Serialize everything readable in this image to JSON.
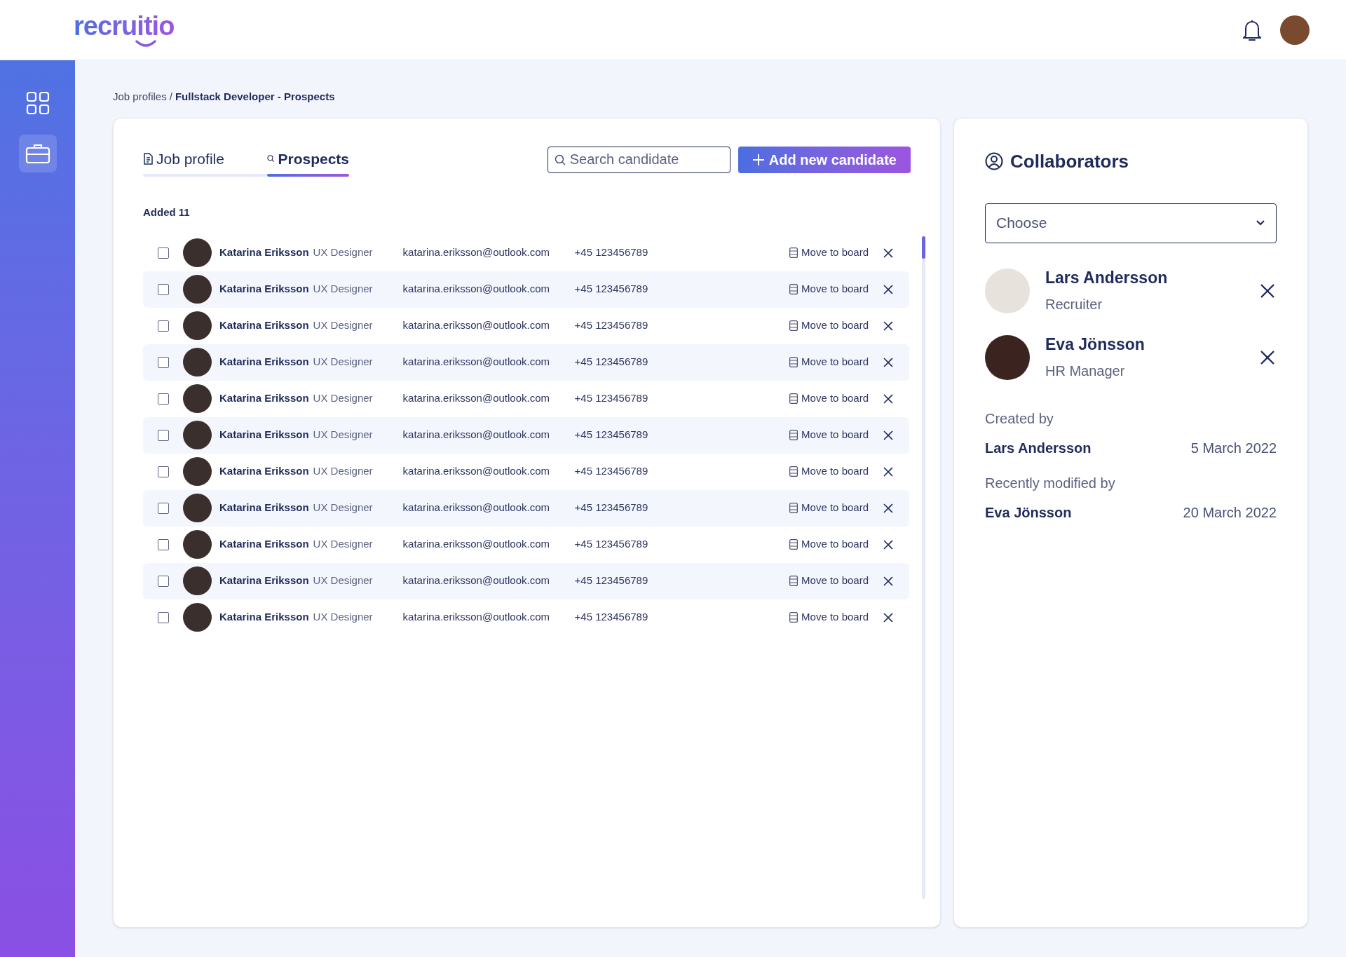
{
  "header": {
    "logo": "recruitio"
  },
  "sidebar": {
    "items": [
      {
        "kind": "grid",
        "selected": false
      },
      {
        "kind": "briefcase",
        "selected": true
      }
    ]
  },
  "breadcrumb": {
    "parent": "Job profiles",
    "separator": "/",
    "current": "Fullstack Developer - Prospects"
  },
  "tabs": [
    {
      "label": "Job profile",
      "kind": "document",
      "selected": false
    },
    {
      "label": "Prospects",
      "kind": "search",
      "selected": true
    }
  ],
  "search": {
    "placeholder": "Search candidate"
  },
  "add_button": {
    "label": "Add new candidate"
  },
  "list_title": "Added 11",
  "candidates": [
    {
      "name": "Katarina Eriksson",
      "role": "UX Designer",
      "email": "katarina.eriksson@outlook.com",
      "phone": "+45 123456789",
      "action": "Move to board",
      "checked": false
    },
    {
      "name": "Katarina Eriksson",
      "role": "UX Designer",
      "email": "katarina.eriksson@outlook.com",
      "phone": "+45 123456789",
      "action": "Move to board",
      "checked": false
    },
    {
      "name": "Katarina Eriksson",
      "role": "UX Designer",
      "email": "katarina.eriksson@outlook.com",
      "phone": "+45 123456789",
      "action": "Move to board",
      "checked": false
    },
    {
      "name": "Katarina Eriksson",
      "role": "UX Designer",
      "email": "katarina.eriksson@outlook.com",
      "phone": "+45 123456789",
      "action": "Move to board",
      "checked": false
    },
    {
      "name": "Katarina Eriksson",
      "role": "UX Designer",
      "email": "katarina.eriksson@outlook.com",
      "phone": "+45 123456789",
      "action": "Move to board",
      "checked": false
    },
    {
      "name": "Katarina Eriksson",
      "role": "UX Designer",
      "email": "katarina.eriksson@outlook.com",
      "phone": "+45 123456789",
      "action": "Move to board",
      "checked": false
    },
    {
      "name": "Katarina Eriksson",
      "role": "UX Designer",
      "email": "katarina.eriksson@outlook.com",
      "phone": "+45 123456789",
      "action": "Move to board",
      "checked": false
    },
    {
      "name": "Katarina Eriksson",
      "role": "UX Designer",
      "email": "katarina.eriksson@outlook.com",
      "phone": "+45 123456789",
      "action": "Move to board",
      "checked": false
    },
    {
      "name": "Katarina Eriksson",
      "role": "UX Designer",
      "email": "katarina.eriksson@outlook.com",
      "phone": "+45 123456789",
      "action": "Move to board",
      "checked": false
    },
    {
      "name": "Katarina Eriksson",
      "role": "UX Designer",
      "email": "katarina.eriksson@outlook.com",
      "phone": "+45 123456789",
      "action": "Move to board",
      "checked": false
    },
    {
      "name": "Katarina Eriksson",
      "role": "UX Designer",
      "email": "katarina.eriksson@outlook.com",
      "phone": "+45 123456789",
      "action": "Move to board",
      "checked": false
    }
  ],
  "collaborators": {
    "title": "Collaborators",
    "select": {
      "placeholder": "Choose"
    },
    "people": [
      {
        "name": "Lars Andersson",
        "role": "Recruiter"
      },
      {
        "name": "Eva Jönsson",
        "role": "HR Manager"
      }
    ],
    "created": {
      "label": "Created by",
      "name": "Lars Andersson",
      "date": "5 March 2022"
    },
    "modified": {
      "label": "Recently modified by",
      "name": "Eva Jönsson",
      "date": "20 March 2022"
    }
  }
}
